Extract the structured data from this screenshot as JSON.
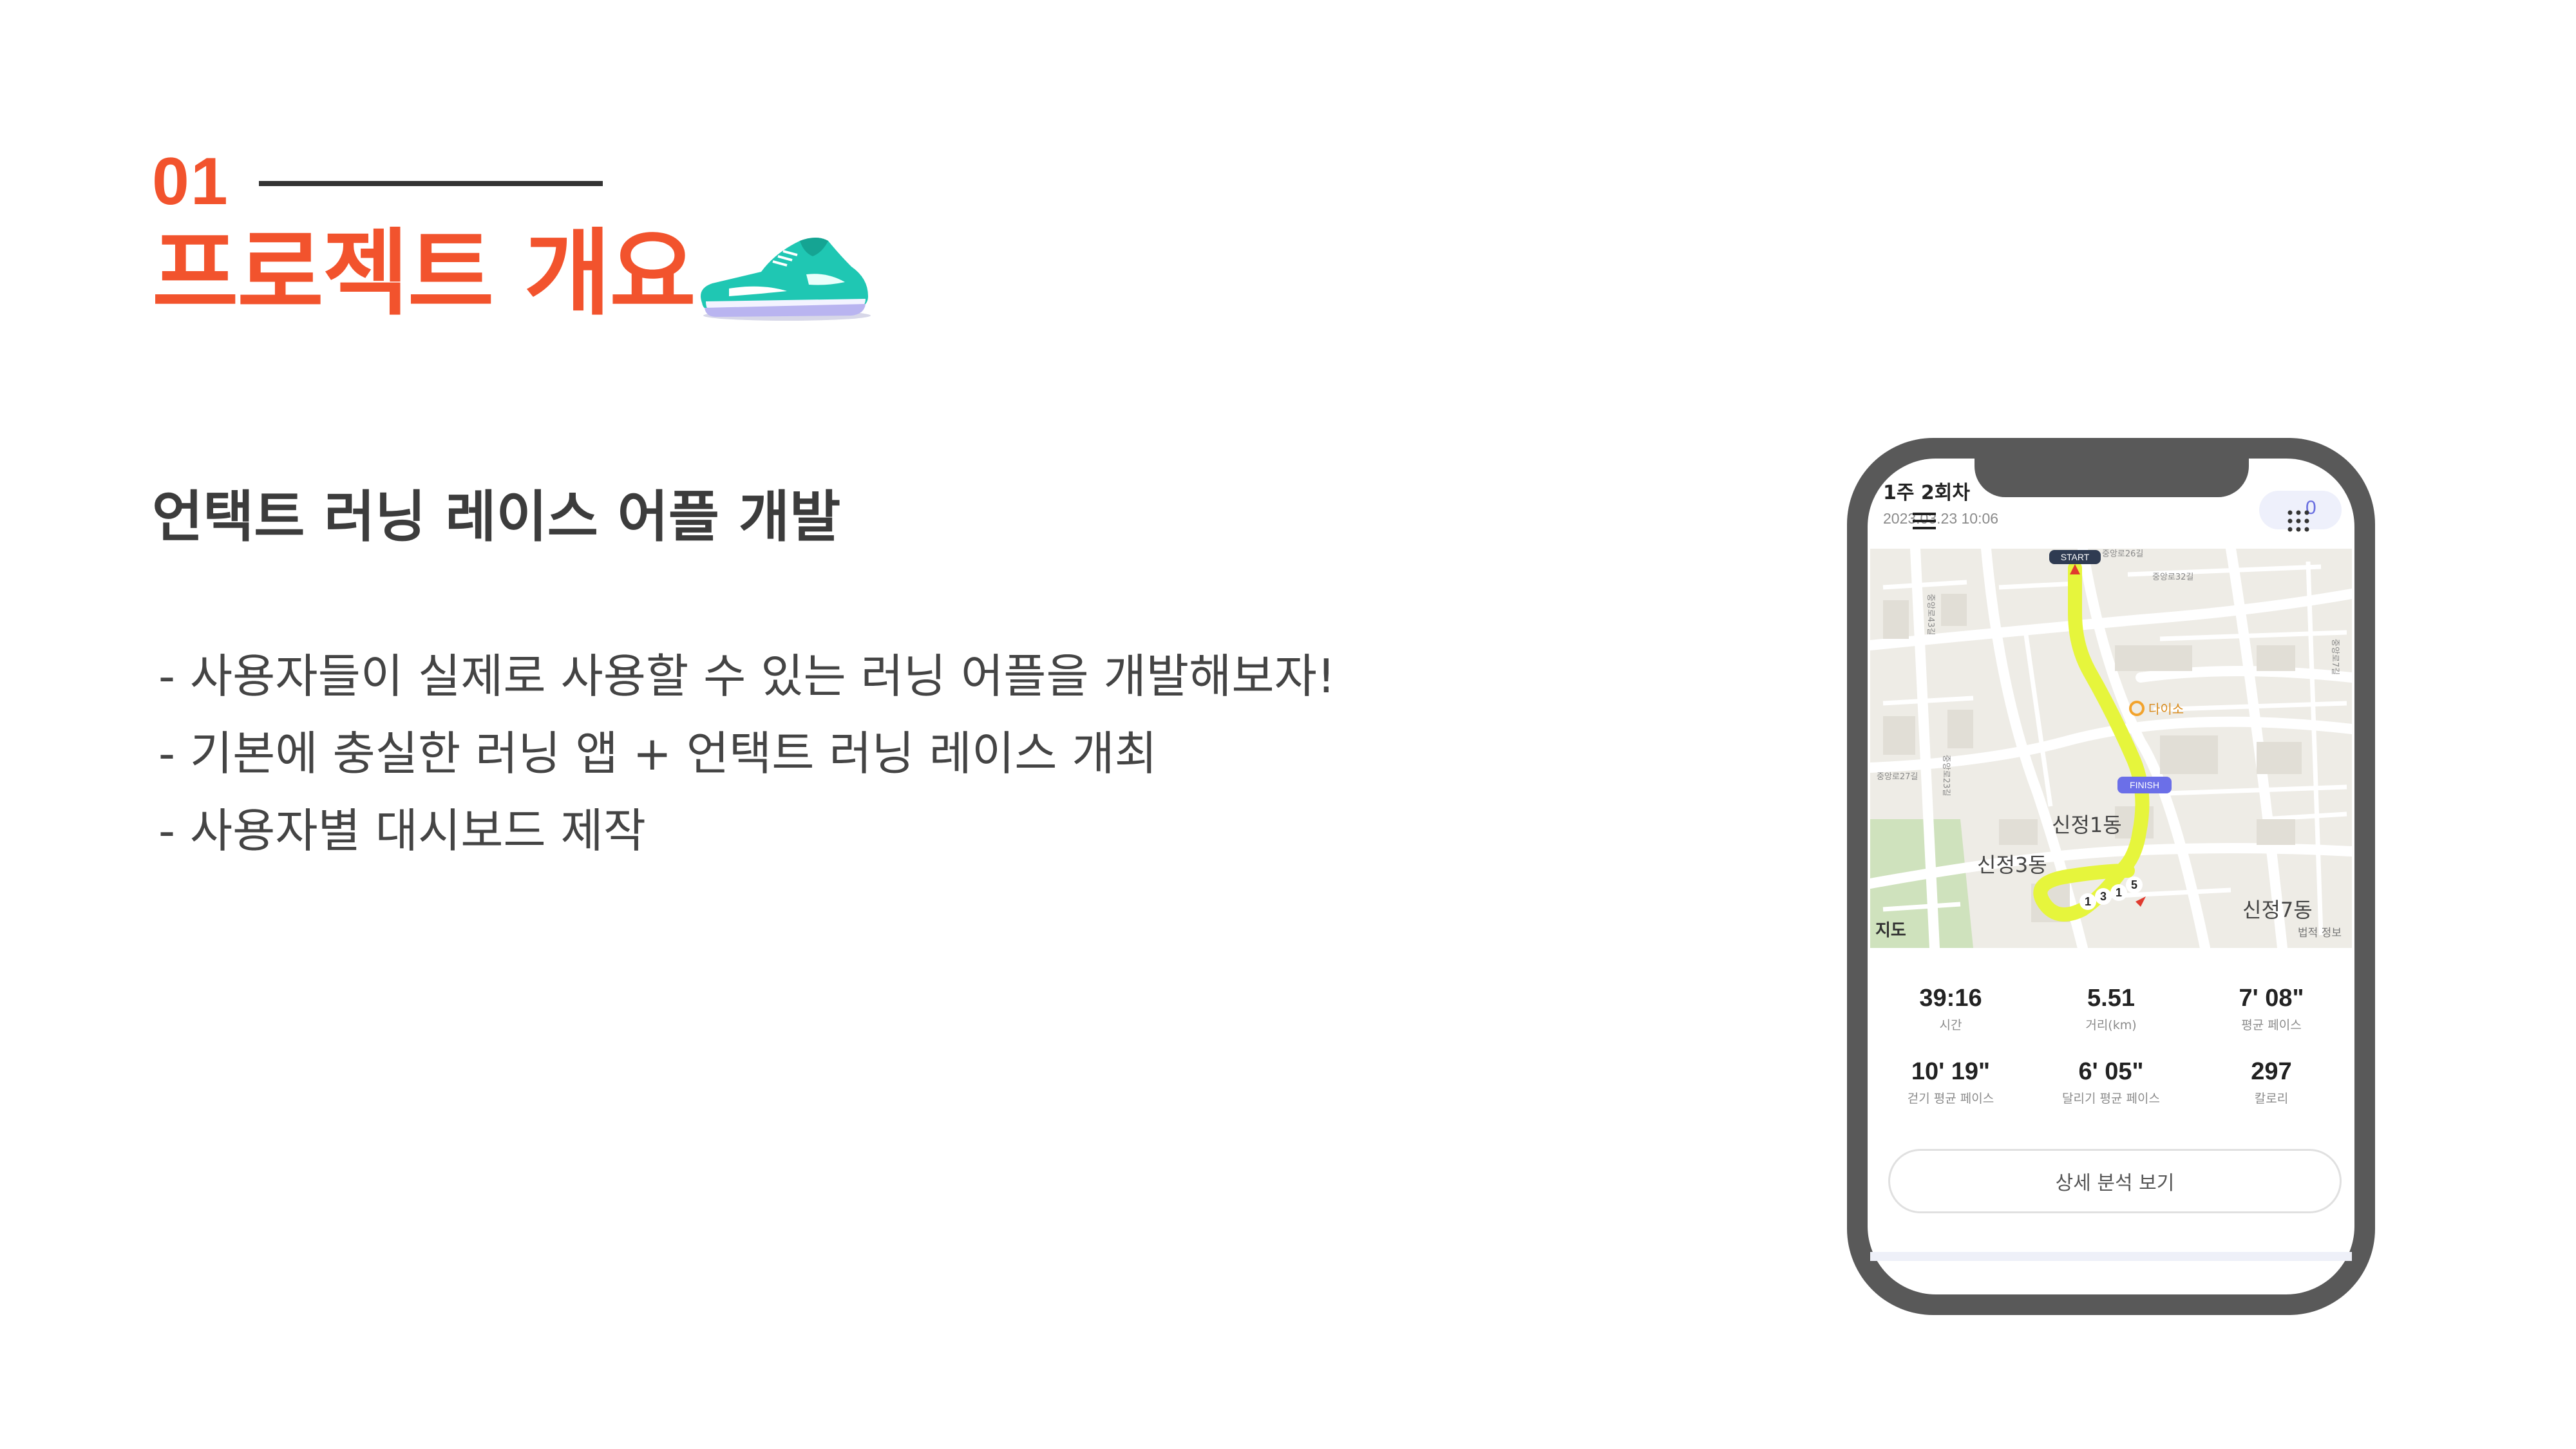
{
  "header": {
    "section_number": "01",
    "section_title": "프로젝트 개요",
    "decoration_icon": "running-shoe-icon"
  },
  "content": {
    "subtitle": "언택트 러닝 레이스 어플 개발",
    "bullets": [
      "- 사용자들이 실제로 사용할 수 있는 러닝 어플을 개발해보자!",
      "- 기본에 충실한 러닝 앱 + 언택트 러닝 레이스 개최",
      "- 사용자별 대시보드 제작"
    ]
  },
  "phone": {
    "run_title": "1주 2회차",
    "run_date": "2023.03.23 10:06",
    "badge_count": "0",
    "map": {
      "start_label": "START",
      "finish_label": "FINISH",
      "poi_label": "다이소",
      "district_labels": [
        "신정1동",
        "신정3동",
        "신정7동"
      ],
      "street_labels": [
        "중앙로32길",
        "중앙로26길",
        "중앙로27길",
        "중앙로23길",
        "중앙로43길",
        "중앙로7길"
      ],
      "km_markers": [
        "1",
        "3",
        "1",
        "5"
      ],
      "attribution": "지도",
      "legal": "법적 정보",
      "route_color": "#e6f53c",
      "start_color": "#2f3b52",
      "finish_color": "#6b6fe8"
    },
    "stats": [
      {
        "value": "39:16",
        "label": "시간"
      },
      {
        "value": "5.51",
        "label": "거리(km)"
      },
      {
        "value": "7' 08\"",
        "label": "평균 페이스"
      },
      {
        "value": "10' 19\"",
        "label": "걷기 평균 페이스"
      },
      {
        "value": "6' 05\"",
        "label": "달리기 평균 페이스"
      },
      {
        "value": "297",
        "label": "칼로리"
      }
    ],
    "detail_button_label": "상세 분석 보기"
  },
  "colors": {
    "accent": "#f2532d",
    "heading": "#3c3c3c",
    "body_text": "#444444",
    "phone_frame": "#595959"
  }
}
